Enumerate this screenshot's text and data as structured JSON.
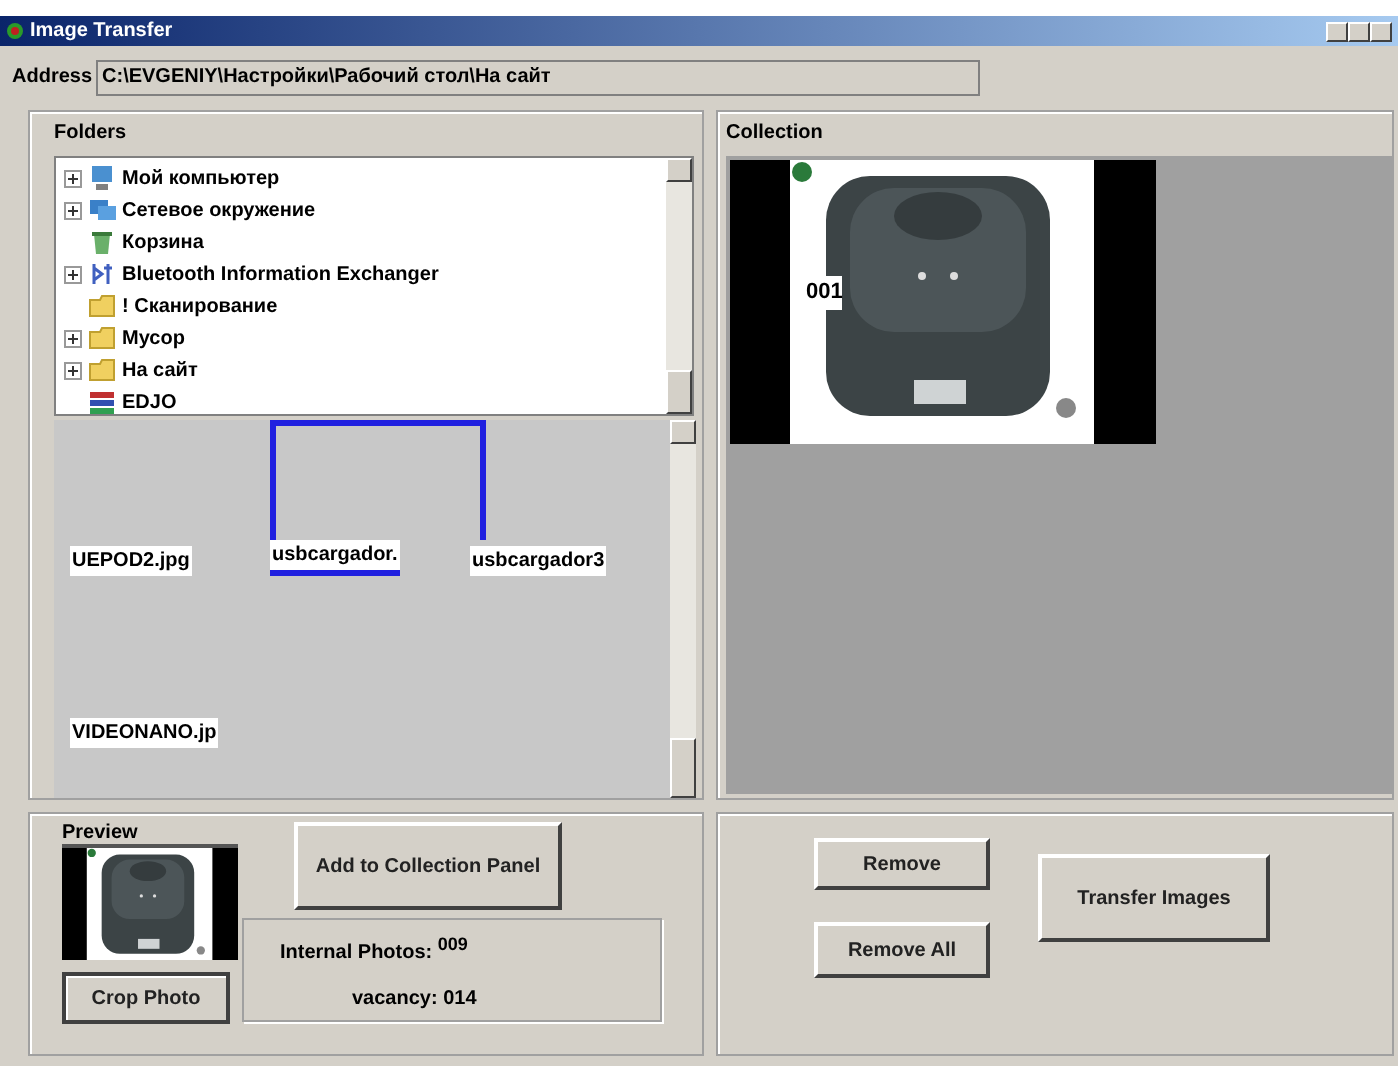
{
  "window": {
    "title": "Image Transfer"
  },
  "address": {
    "label": "Address",
    "value": "C:\\EVGENIY\\Настройки\\Рабочий стол\\На сайт"
  },
  "folders": {
    "title": "Folders",
    "tree": [
      {
        "label": "Мой компьютер",
        "kind": "computer",
        "expandable": true
      },
      {
        "label": "Сетевое окружение",
        "kind": "network",
        "expandable": true
      },
      {
        "label": "Корзина",
        "kind": "bin",
        "expandable": false
      },
      {
        "label": "Bluetooth Information Exchanger",
        "kind": "bluetooth",
        "expandable": true
      },
      {
        "label": "! Сканирование",
        "kind": "folder",
        "expandable": false
      },
      {
        "label": "Мусор",
        "kind": "folder",
        "expandable": true
      },
      {
        "label": "На сайт",
        "kind": "folder",
        "expandable": true
      },
      {
        "label": "EDJO",
        "kind": "archive",
        "expandable": false
      }
    ],
    "files": [
      {
        "label": "UEPOD2.jpg",
        "selected": false
      },
      {
        "label": "usbcargador.",
        "selected": true
      },
      {
        "label": "usbcargador3",
        "selected": false
      },
      {
        "label": "VIDEONANO.jp",
        "selected": false
      }
    ]
  },
  "collection": {
    "title": "Collection",
    "items": [
      {
        "label": "001",
        "kind": "picture"
      }
    ]
  },
  "preview": {
    "title": "Preview",
    "crop_button": "Crop Photo",
    "add_button": "Add to Collection Panel",
    "internal_photos_label": "Internal Photos:",
    "internal_photos": "009",
    "vacancy_label": "vacancy:",
    "vacancy": "014"
  },
  "buttons": {
    "remove": "Remove",
    "remove_all": "Remove All",
    "transfer": "Transfer Images"
  }
}
